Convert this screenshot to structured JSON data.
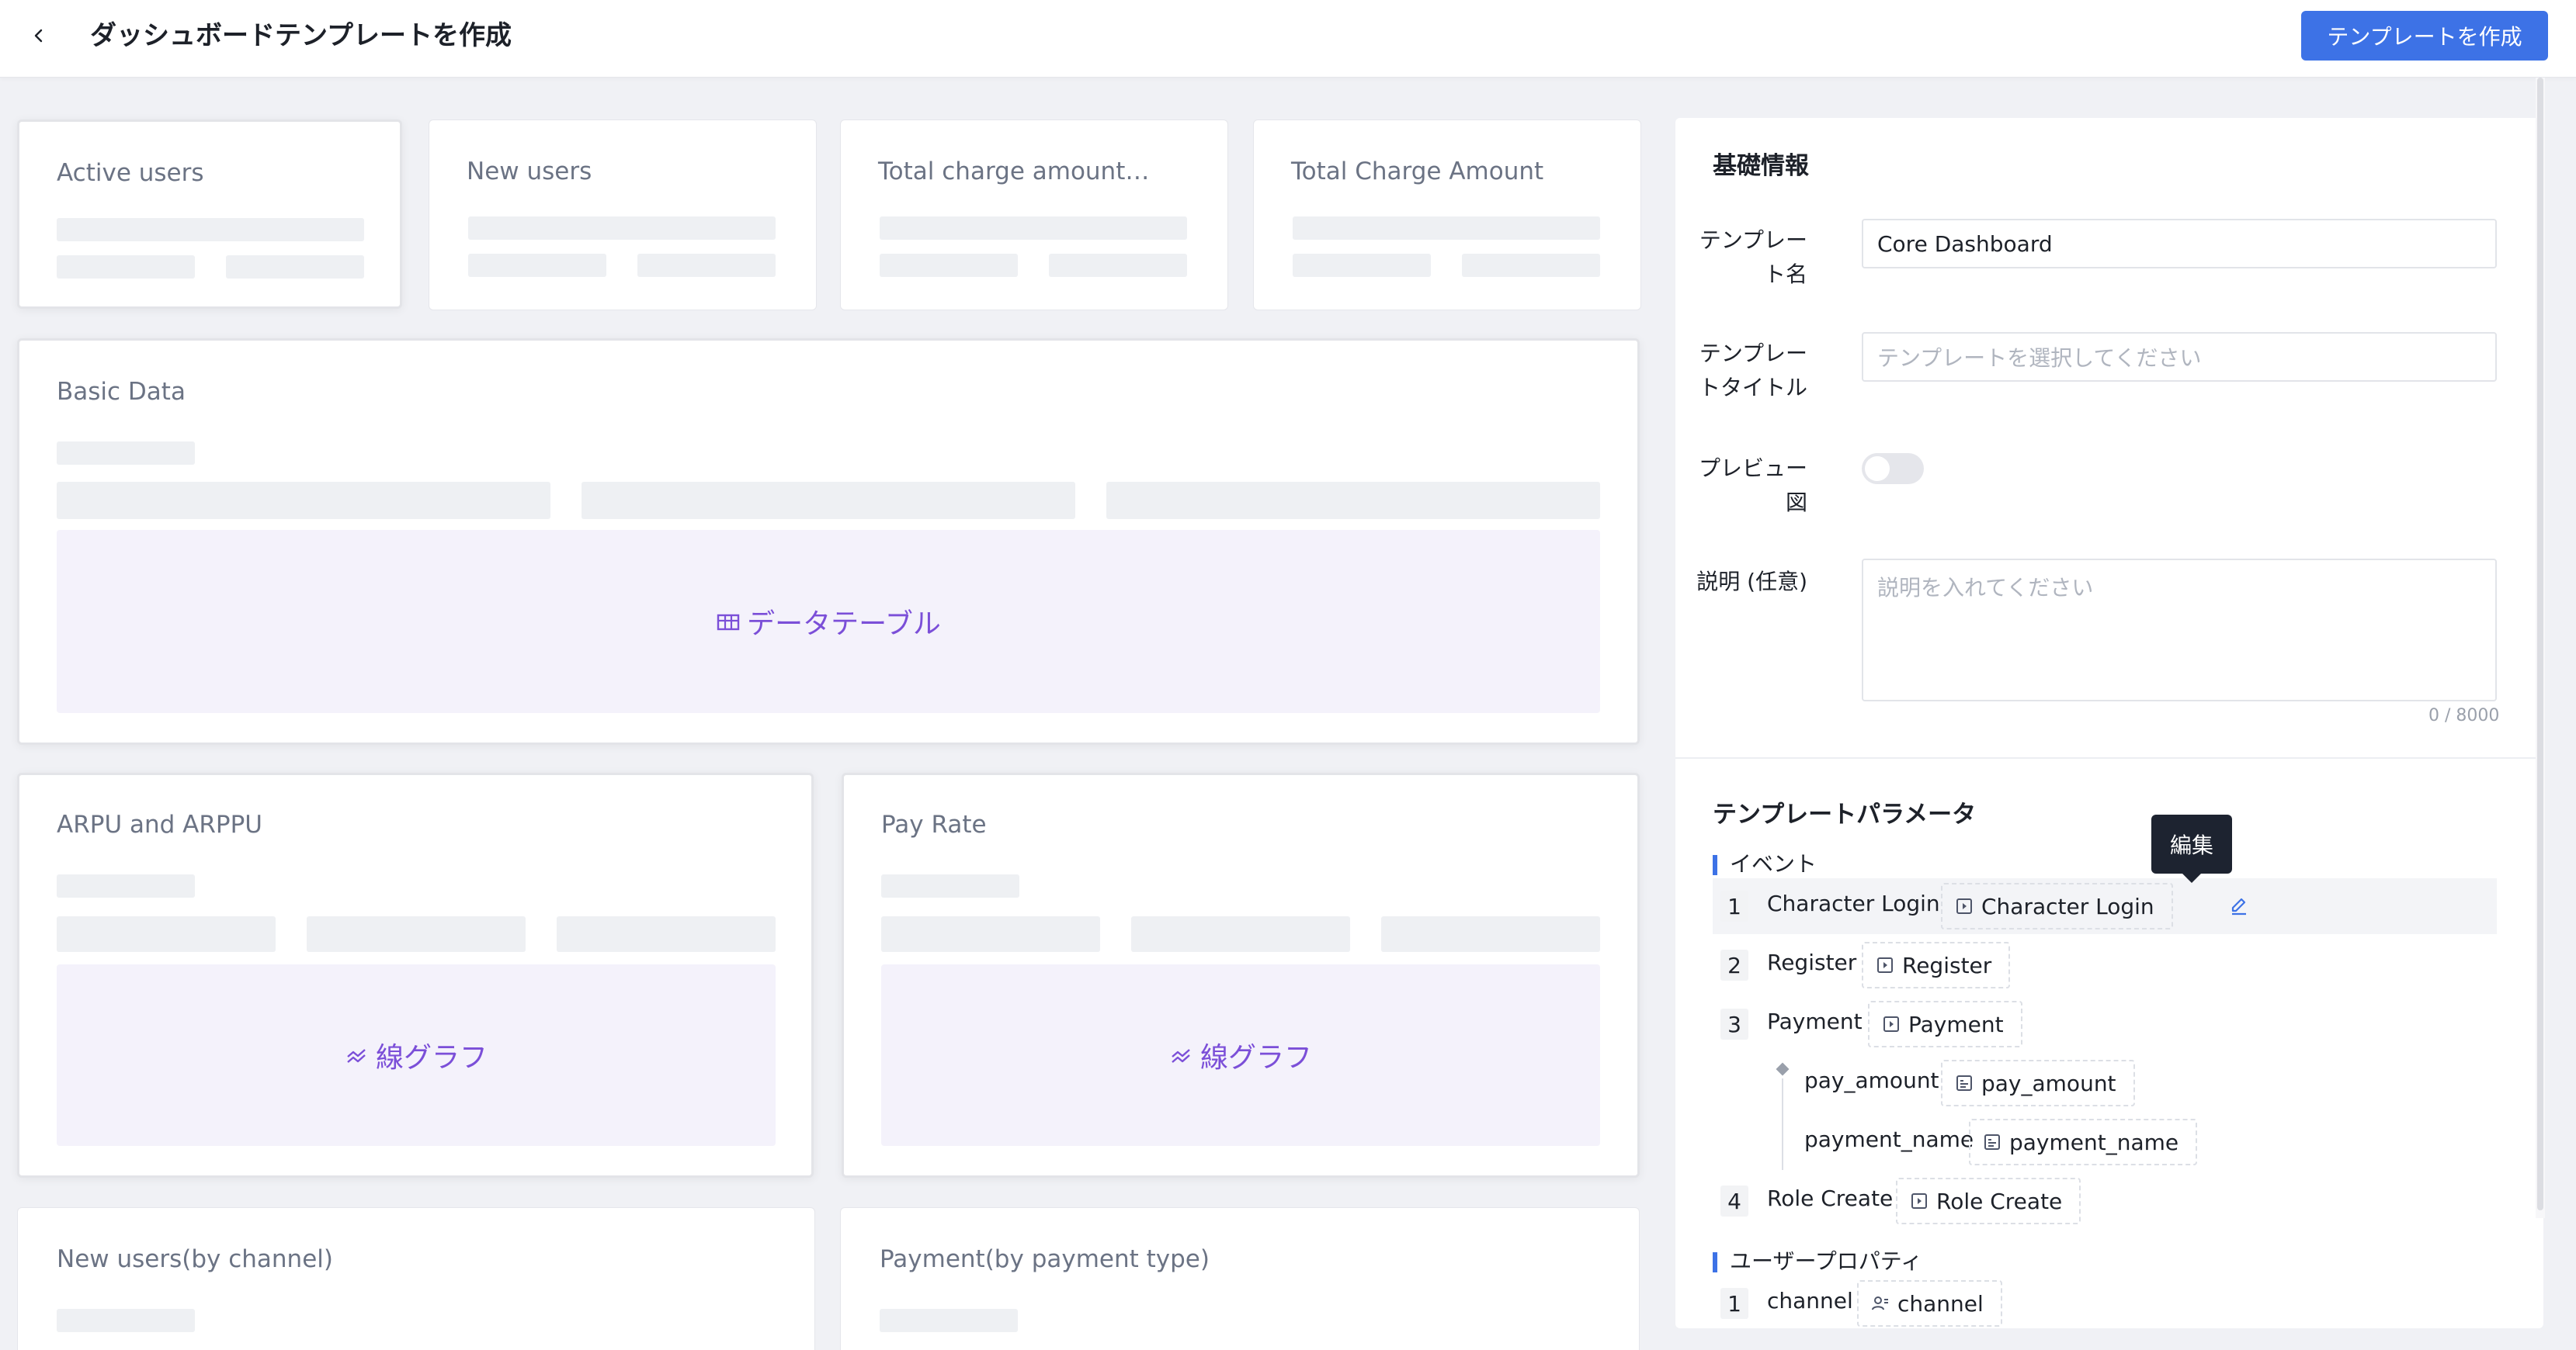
{
  "header": {
    "title": "ダッシュボードテンプレートを作成",
    "create_button": "テンプレートを作成"
  },
  "cards": {
    "active_users": "Active users",
    "new_users": "New users",
    "total_charge_amount_1": "Total charge amount…",
    "total_charge_amount_2": "Total Charge Amount",
    "basic_data": "Basic Data",
    "arpu": "ARPU and ARPPU",
    "pay_rate": "Pay Rate",
    "new_users_by_channel": "New users(by channel)",
    "payment_by_type": "Payment(by payment type)"
  },
  "placeholders": {
    "data_table": "データテーブル",
    "line_chart": "線グラフ"
  },
  "basic_info": {
    "section_title": "基礎情報",
    "template_name_label_1": "テンプレー",
    "template_name_label_2": "ト名",
    "template_name_value": "Core Dashboard",
    "template_title_label_1": "テンプレー",
    "template_title_label_2": "トタイトル",
    "template_title_placeholder": "テンプレートを選択してください",
    "preview_label_1": "プレビュー",
    "preview_label_2": "図",
    "preview_enabled": false,
    "description_label": "説明 (任意)",
    "description_placeholder": "説明を入れてください",
    "description_counter": "0 / 8000"
  },
  "template_params": {
    "section_title": "テンプレートパラメータ",
    "events_label": "イベント",
    "events": [
      {
        "index": "1",
        "name": "Character Login",
        "chip": "Character Login"
      },
      {
        "index": "2",
        "name": "Register",
        "chip": "Register"
      },
      {
        "index": "3",
        "name": "Payment",
        "chip": "Payment"
      },
      {
        "index": "4",
        "name": "Role Create",
        "chip": "Role Create"
      }
    ],
    "payment_props": [
      {
        "name": "pay_amount",
        "chip": "pay_amount"
      },
      {
        "name": "payment_name",
        "chip": "payment_name"
      }
    ],
    "edit_tooltip": "編集",
    "user_props_label": "ユーザープロパティ",
    "user_props": [
      {
        "index": "1",
        "name": "channel",
        "chip": "channel"
      }
    ]
  },
  "colors": {
    "accent": "#3d72e6",
    "placeholder_purple": "#7b4fd8"
  }
}
